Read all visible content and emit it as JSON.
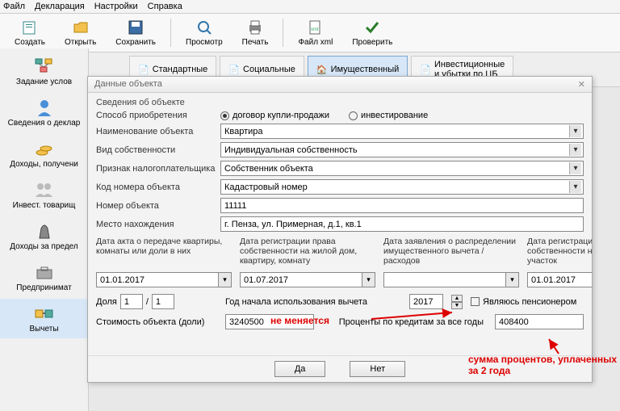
{
  "menubar": [
    "Файл",
    "Декларация",
    "Настройки",
    "Справка"
  ],
  "toolbar": [
    {
      "id": "create",
      "label": "Создать"
    },
    {
      "id": "open",
      "label": "Открыть"
    },
    {
      "id": "save",
      "label": "Сохранить"
    },
    {
      "id": "view",
      "label": "Просмотр"
    },
    {
      "id": "print",
      "label": "Печать"
    },
    {
      "id": "xml",
      "label": "Файл xml"
    },
    {
      "id": "check",
      "label": "Проверить"
    }
  ],
  "tabs": [
    {
      "id": "std",
      "label": "Стандартные"
    },
    {
      "id": "soc",
      "label": "Социальные"
    },
    {
      "id": "prop",
      "label": "Имущественный"
    },
    {
      "id": "inv",
      "label": "Инвестиционные и убытки по ЦБ"
    }
  ],
  "active_tab": "prop",
  "sidebar": [
    {
      "id": "cond",
      "label": "Задание услов"
    },
    {
      "id": "decl",
      "label": "Сведения о деклар"
    },
    {
      "id": "income",
      "label": "Доходы, получени"
    },
    {
      "id": "invtov",
      "label": "Инвест. товарищ"
    },
    {
      "id": "abroad",
      "label": "Доходы за предел"
    },
    {
      "id": "entrepr",
      "label": "Предпринимат"
    },
    {
      "id": "deduct",
      "label": "Вычеты"
    }
  ],
  "active_side": "deduct",
  "dialog": {
    "title": "Данные объекта",
    "section": "Сведения об объекте",
    "labels": {
      "method": "Способ приобретения",
      "name": "Наименование объекта",
      "owner_type": "Вид собственности",
      "taxpayer": "Признак налогоплательщика",
      "code": "Код номера объекта",
      "number": "Номер объекта",
      "location": "Место нахождения",
      "share": "Доля",
      "cost": "Стоимость объекта (доли)"
    },
    "radio": {
      "purchase": "договор купли-продажи",
      "invest": "инвестирование",
      "selected": "purchase"
    },
    "values": {
      "name": "Квартира",
      "owner_type": "Индивидуальная собственность",
      "taxpayer": "Собственник объекта",
      "code": "Кадастровый номер",
      "number": "11111",
      "location": "г. Пенза, ул. Примерная, д.1, кв.1",
      "share_n": "1",
      "share_d": "1",
      "cost": "3240500",
      "year": "2017",
      "credit": "408400"
    },
    "date_cols": [
      {
        "label": "Дата акта о передаче квартиры, комнаты или доли в них",
        "value": "01.01.2017"
      },
      {
        "label": "Дата регистрации права собственности на жилой дом, квартиру, комнату",
        "value": "01.07.2017"
      },
      {
        "label": "Дата заявления о распределении имущественного вычета / расходов",
        "value": ""
      },
      {
        "label": "Дата регистрации права собственности на земельный участок",
        "value": "01.01.2017"
      }
    ],
    "year_label": "Год начала использования вычета",
    "credit_label": "Проценты по кредитам за все годы",
    "pensioner": "Являюсь пенсионером",
    "buttons": {
      "yes": "Да",
      "no": "Нет"
    }
  },
  "annotations": {
    "a1": "не меняется",
    "a2": "сумма процентов, уплаченных за 2 года"
  }
}
